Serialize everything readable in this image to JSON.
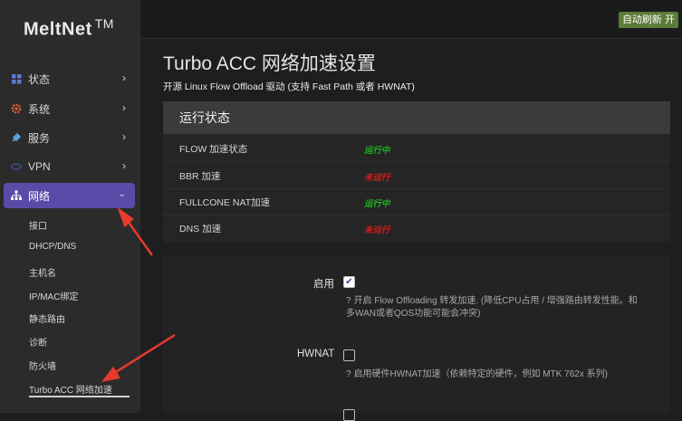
{
  "brand": {
    "name": "MeltNet",
    "mark": "TM"
  },
  "sidebar": {
    "items": [
      {
        "label": "状态"
      },
      {
        "label": "系统"
      },
      {
        "label": "服务"
      },
      {
        "label": "VPN"
      },
      {
        "label": "网络"
      }
    ],
    "sub_items": [
      {
        "label": "接口"
      },
      {
        "label": "DHCP/DNS"
      },
      {
        "label": "主机名"
      },
      {
        "label": "IP/MAC绑定"
      },
      {
        "label": "静态路由"
      },
      {
        "label": "诊断"
      },
      {
        "label": "防火墙"
      },
      {
        "label": "Turbo ACC 网络加速"
      }
    ]
  },
  "topbar": {
    "refresh_label": "自动刷新 开"
  },
  "page": {
    "title": "Turbo ACC 网络加速设置",
    "description": "开源 Linux Flow Offload 驱动 (支持 Fast Path 或者 HWNAT)"
  },
  "status": {
    "heading": "运行状态",
    "rows": [
      {
        "label": "FLOW 加速状态",
        "value": "运行中",
        "state": "running"
      },
      {
        "label": "BBR 加速",
        "value": "未运行",
        "state": "stopped"
      },
      {
        "label": "FULLCONE NAT加速",
        "value": "运行中",
        "state": "running"
      },
      {
        "label": "DNS 加速",
        "value": "未运行",
        "state": "stopped"
      }
    ]
  },
  "form": {
    "enable": {
      "label": "启用",
      "checked": true,
      "help_line1": "开启 Flow Offloading 转发加速. (降低CPU占用 / 增强路由转发性能。和",
      "help_line2": "多WAN或者QOS功能可能会冲突)"
    },
    "hwnat": {
      "label": "HWNAT",
      "checked": false,
      "help_line1": "启用硬件HWNAT加速（依赖特定的硬件，例如 MTK 762x 系列)"
    }
  },
  "colors": {
    "sidebar_active": "#5b4ba8",
    "running": "#1fb51f",
    "stopped": "#d81c1c",
    "refresh_button": "#5d7b39",
    "annotation_arrow": "#e63b2e"
  }
}
